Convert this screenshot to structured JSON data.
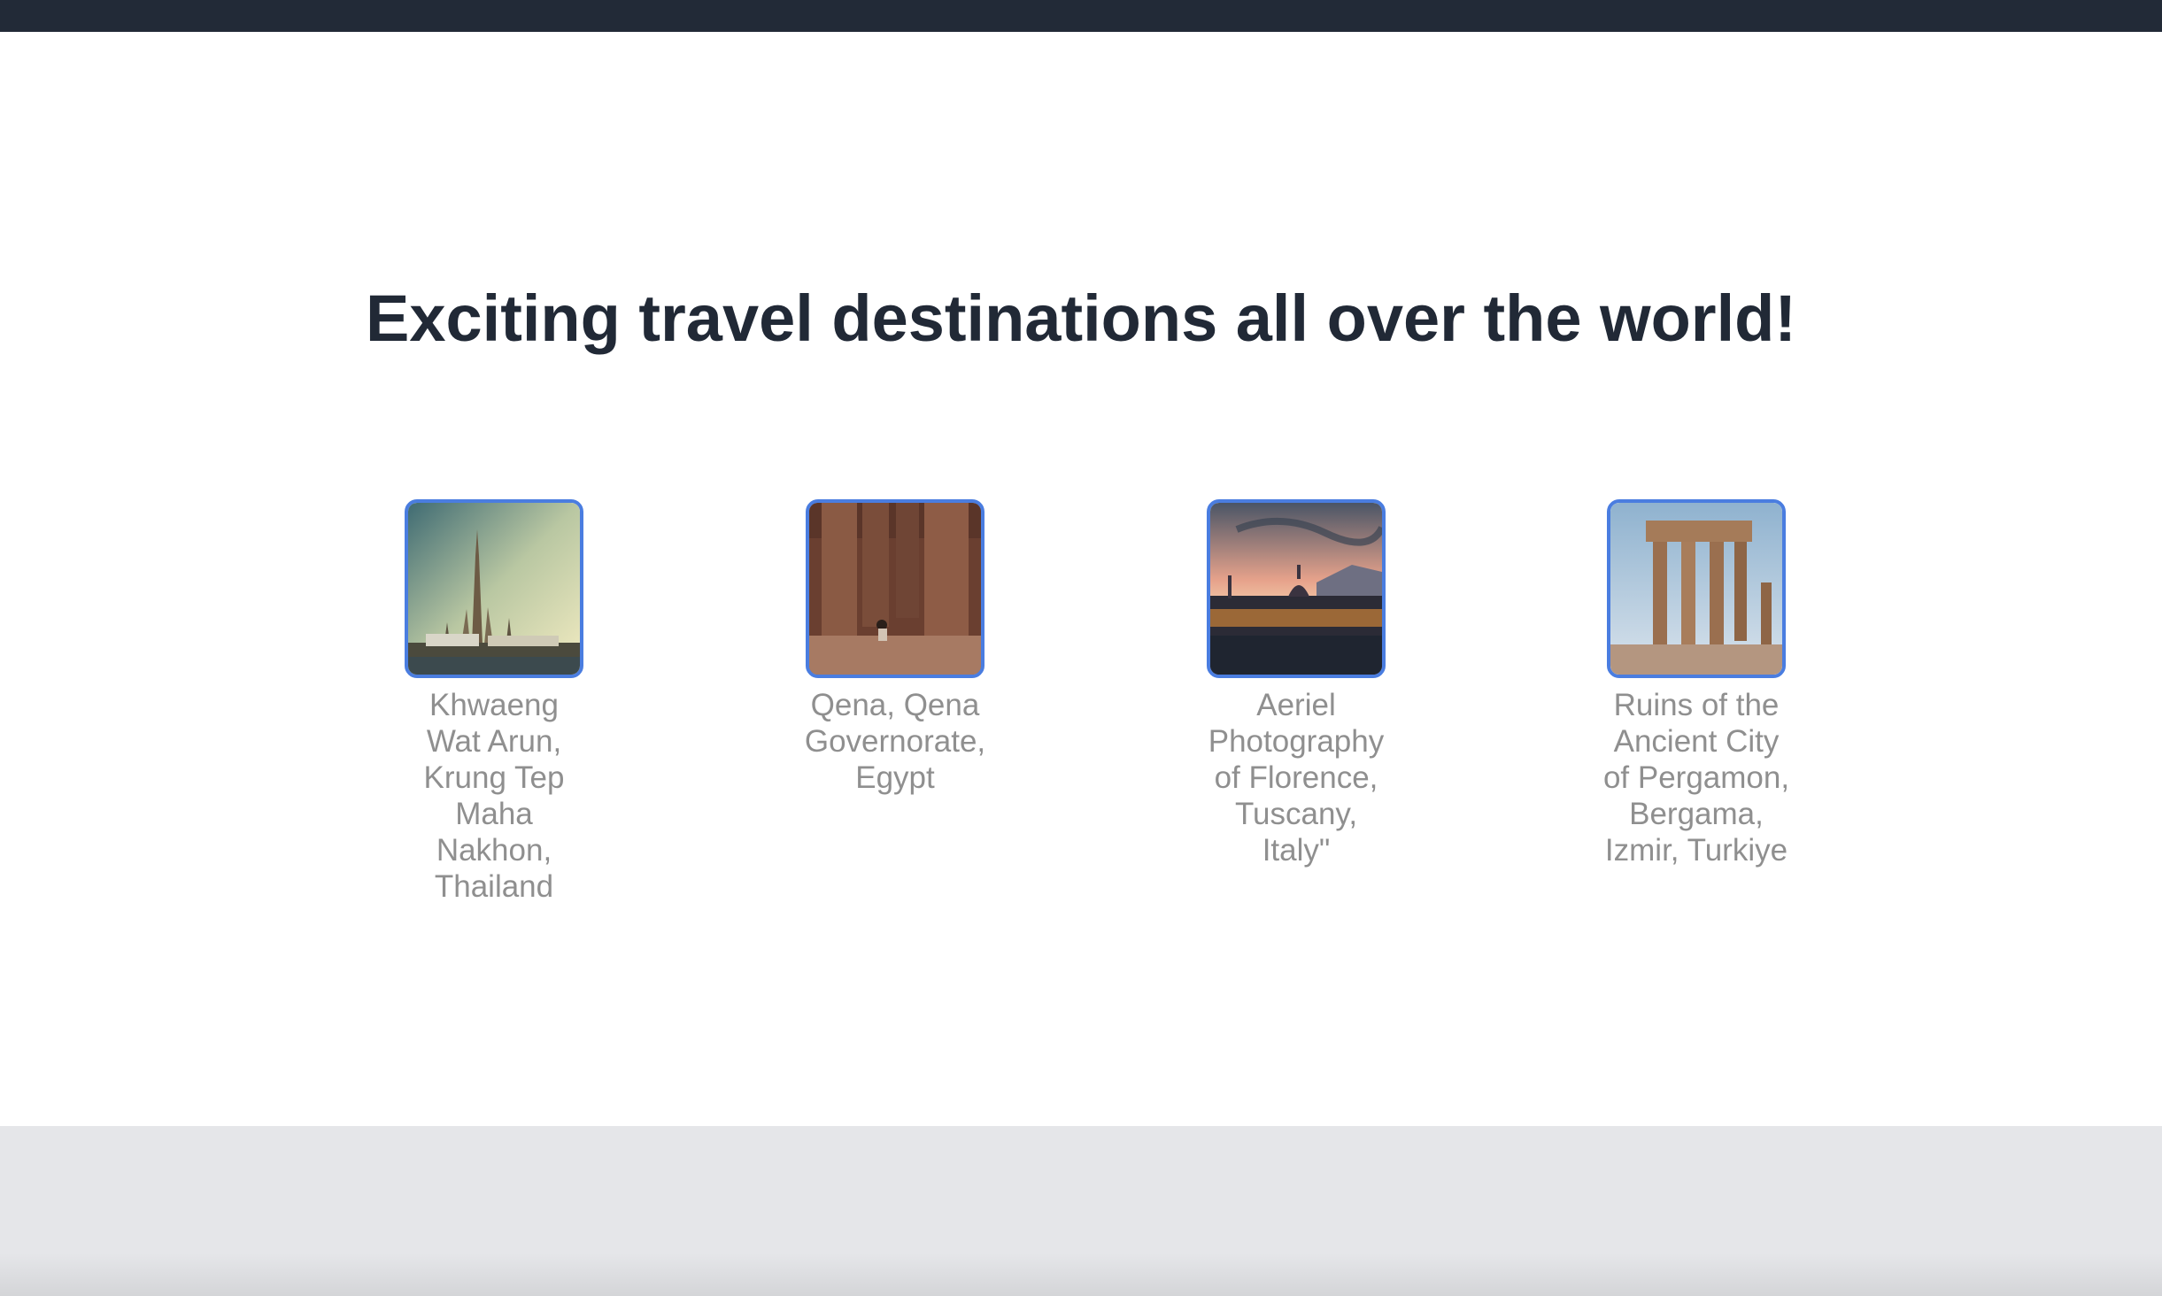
{
  "page": {
    "headline": "Exciting travel destinations all over the world!"
  },
  "destinations": [
    {
      "caption": "Khwaeng Wat Arun, Krung Tep Maha Nakhon, Thailand",
      "image": "temple-photo"
    },
    {
      "caption": "Qena, Qena Governorate, Egypt",
      "image": "temple-columns-photo"
    },
    {
      "caption": "Aeriel Photography of Florence, Tuscany, Italy\"",
      "image": "city-skyline-photo"
    },
    {
      "caption": "Ruins of the Ancient City of Pergamon, Bergama, Izmir, Turkiye",
      "image": "ancient-ruins-photo"
    }
  ],
  "colors": {
    "topbar": "#222a37",
    "headline": "#212936",
    "caption": "#8f8f8f",
    "thumbnail_border": "#4a7de0",
    "footer": "#e5e6e9"
  }
}
